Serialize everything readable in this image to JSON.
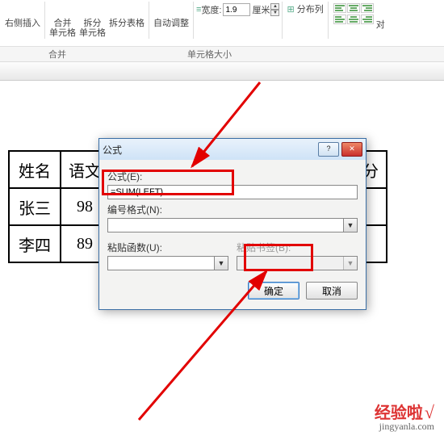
{
  "ribbon": {
    "insert_right": "右侧插入",
    "merge": "合并",
    "merge_sub": "单元格",
    "split": "拆分",
    "split_sub": "单元格",
    "split_table": "拆分表格",
    "autofit": "自动调整",
    "width_icon": "≡",
    "width_label": "宽度:",
    "width_value": "1.9",
    "width_unit": "厘米",
    "distribute": "分布列",
    "align_suffix": "对"
  },
  "groups": {
    "merge_group": "合并",
    "size_group": "单元格大小"
  },
  "table": {
    "headers": [
      "姓名",
      "语文",
      "总分"
    ],
    "rows": [
      {
        "name": "张三",
        "score": "98"
      },
      {
        "name": "李四",
        "score": "89"
      }
    ]
  },
  "dialog": {
    "title": "公式",
    "formula_label": "公式(E):",
    "formula_value": "=SUM(LEFT)",
    "number_format_label": "编号格式(N):",
    "number_format_value": "",
    "paste_func_label": "粘贴函数(U):",
    "paste_func_value": "",
    "paste_bookmark_label": "粘贴书签(B):",
    "paste_bookmark_value": "",
    "ok": "确定",
    "cancel": "取消",
    "help_icon": "?",
    "close_icon": "✕"
  },
  "watermark": {
    "line1": "经验啦",
    "check": "√",
    "line2": "jingyanla.com"
  }
}
